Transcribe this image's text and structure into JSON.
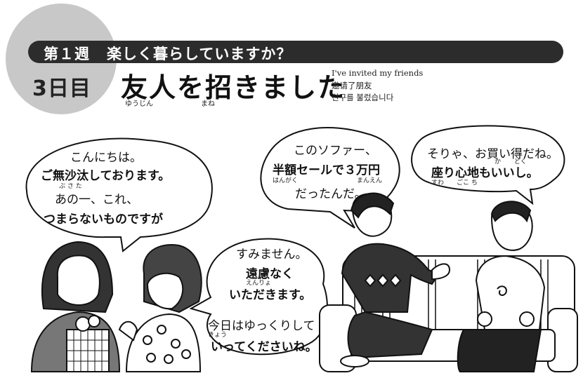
{
  "header": {
    "week": "第１週",
    "theme": "楽しく暮らしていますか？",
    "day": "3日目",
    "title": "友人を招きました",
    "title_ruby": [
      "ゆうじん",
      "まね"
    ],
    "translation_en": "I've invited my friends",
    "translation_zh": "邀请了朋友",
    "translation_ko": "친구를 불렀습니다"
  },
  "bubbles": {
    "woman": {
      "line1": "こんにちは。",
      "line2": "ご無沙汰しております。",
      "ruby": "ぶ さ た",
      "line3": "あの一、これ、",
      "line4": "つまらないものですが"
    },
    "girl": {
      "line1": "すみません。",
      "line2": "遠慮なく",
      "ruby": "えんりょ",
      "line3": "いただきます。",
      "line4": "今日はゆっくりして",
      "ruby2": "きょう",
      "line5": "いってくださいね。"
    },
    "man_left": {
      "line1": "このソファー、",
      "line2": "半額セールで３万円",
      "ruby_a": "はんがく",
      "ruby_b": "まんえん",
      "line3": "だったんだ。"
    },
    "man_right": {
      "line1": "そりゃ、お買い得だね。",
      "ruby_a": "か",
      "ruby_b": "どく",
      "line2": "座り心地もいいし。",
      "ruby_c": "すわ",
      "ruby_d": "ごこ ち"
    }
  },
  "colors": {
    "bar": "#2c2c2c",
    "circle": "#c8c8c8",
    "line": "#111111"
  }
}
